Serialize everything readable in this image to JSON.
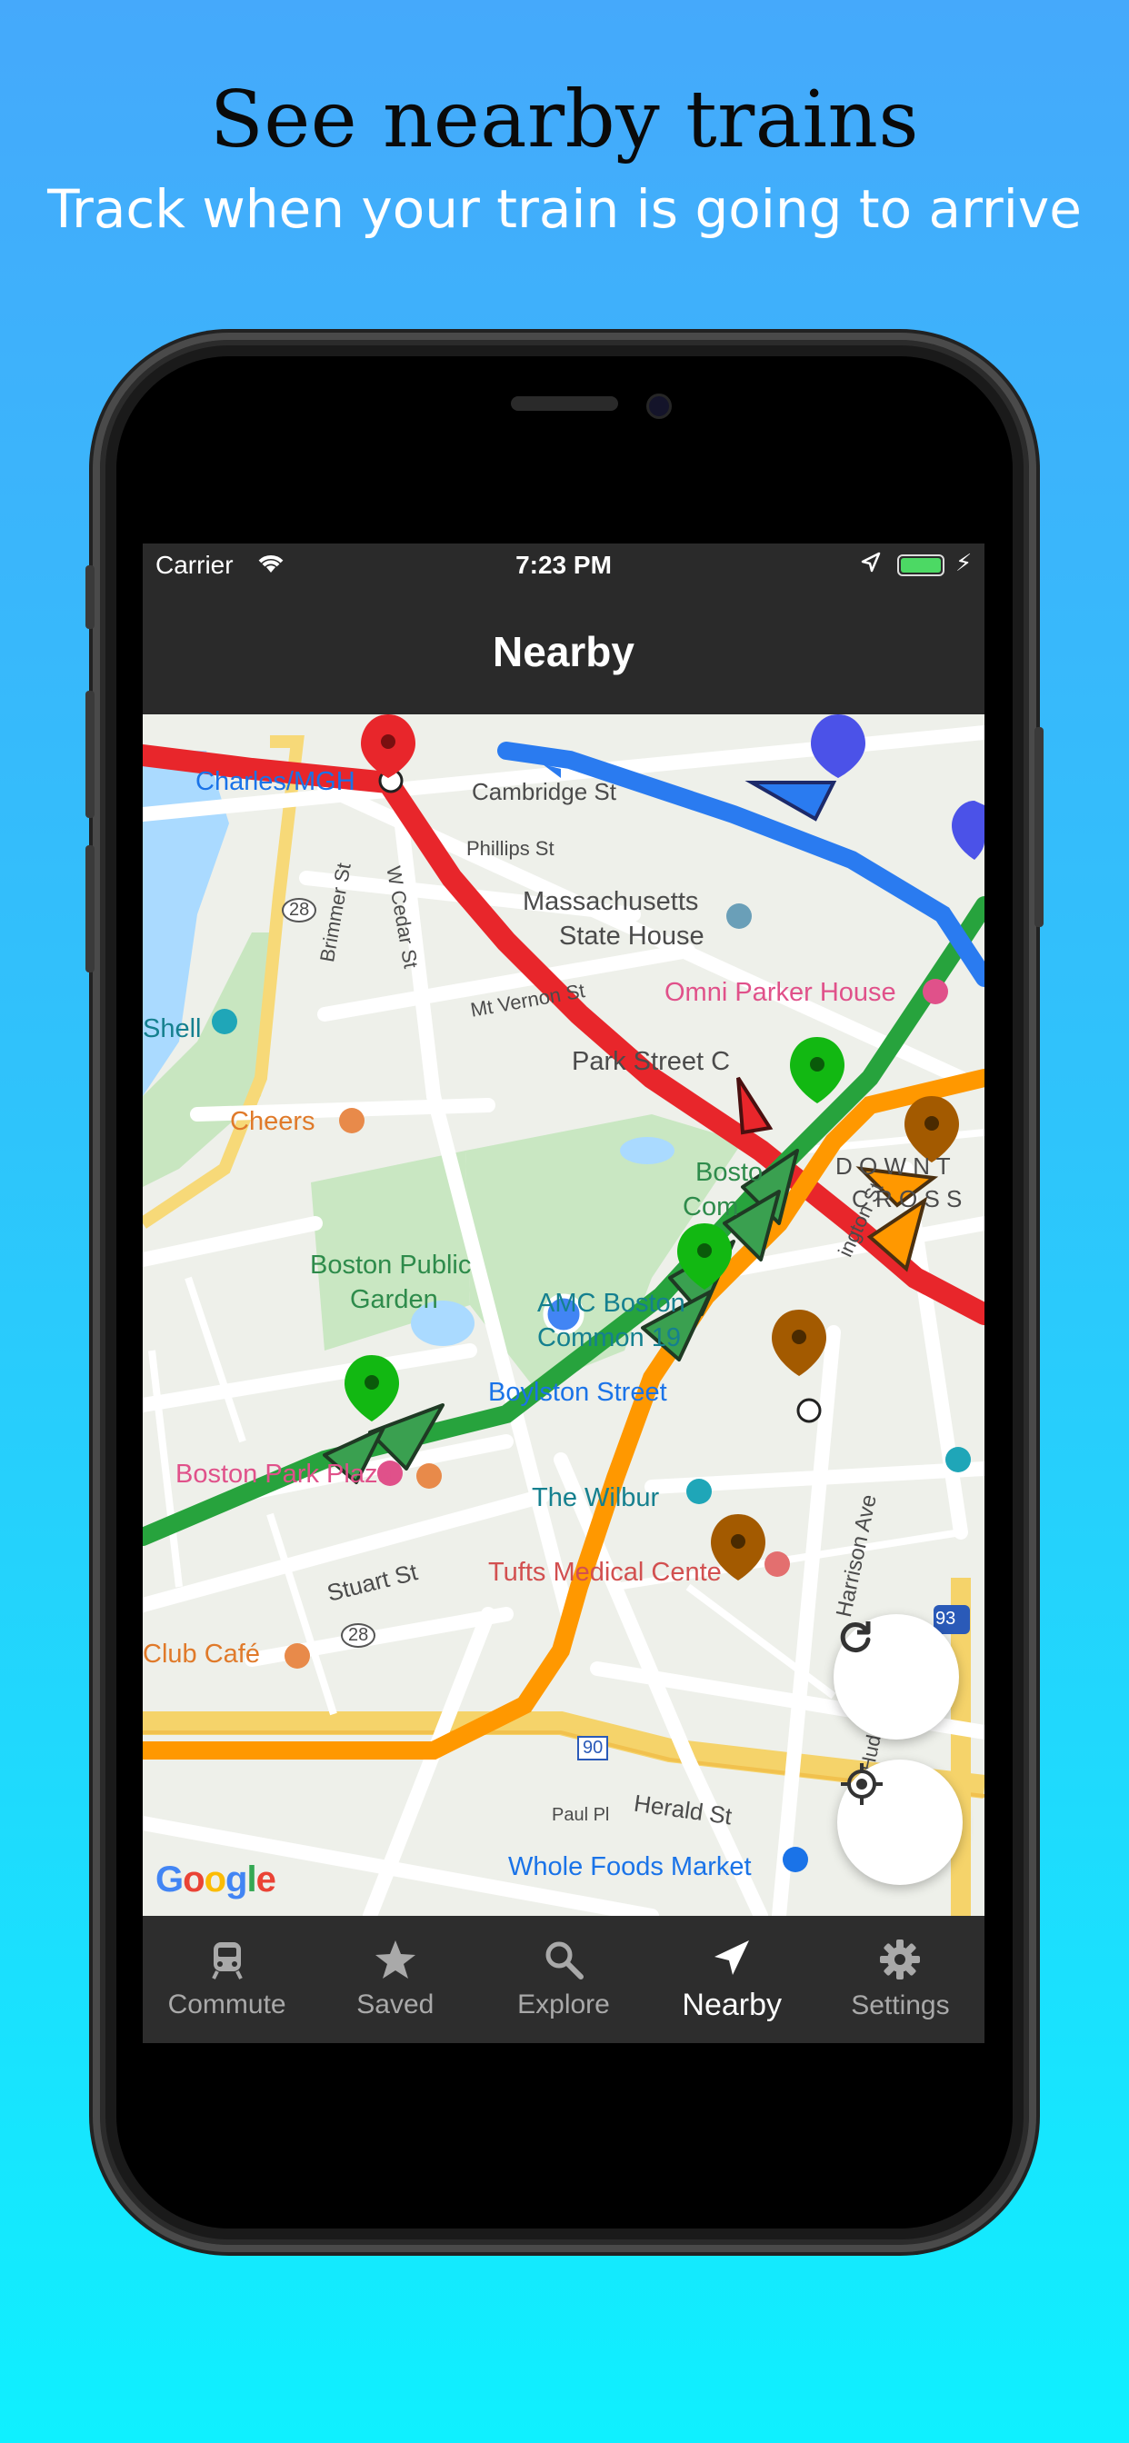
{
  "headline": "See nearby trains",
  "subheadline": "Track when your train is going to arrive",
  "status_bar": {
    "carrier": "Carrier",
    "time": "7:23 PM",
    "wifi_icon": "wifi-icon",
    "location_icon": "location-arrow-icon",
    "battery_icon": "battery-icon"
  },
  "nav": {
    "title": "Nearby"
  },
  "map": {
    "labels": {
      "charles_mgh": "Charles/MGH",
      "cambridge_st": "Cambridge St",
      "phillips_st": "Phillips St",
      "w_cedar_st": "W Cedar St",
      "route_28": "28",
      "ma_state_house_1": "Massachusetts",
      "ma_state_house_2": "State House",
      "brimmer_st": "Brimmer St",
      "mt_vernon_st": "Mt Vernon St",
      "omni": "Omni Parker House",
      "shell": "Shell",
      "park_street": "Park Street C",
      "cheers": "Cheers",
      "boston_common_1": "Bosto",
      "boston_common_2": "Com",
      "downtown_1": "D O W N T",
      "downtown_2": "C R O S S",
      "public_garden_1": "Boston Public",
      "public_garden_2": "Garden",
      "amc_1": "AMC Boston",
      "amc_2": "Common 19",
      "washington_st": "ington St",
      "boylston": "Boylston Street",
      "park_plaza": "Boston Park Plaza",
      "wilbur": "The Wilbur",
      "harrison": "Harrison Ave",
      "stuart_st": "Stuart St",
      "tufts": "Tufts Medical Cente",
      "route_28b": "28",
      "club_cafe": "Club Café",
      "route_93": "93",
      "route_90": "90",
      "hud": "Hud",
      "herald_st": "Herald St",
      "paul_pl": "Paul Pl",
      "whole_foods": "Whole Foods Market",
      "google": "Google"
    },
    "line_colors": {
      "red": "#e8262b",
      "green": "#27a33d",
      "orange": "#ff9800",
      "blue": "#2a7bf0"
    },
    "refresh_icon": "refresh-icon",
    "locate_icon": "locate-icon"
  },
  "tabs": [
    {
      "label": "Commute",
      "icon": "train-icon",
      "active": false
    },
    {
      "label": "Saved",
      "icon": "star-icon",
      "active": false
    },
    {
      "label": "Explore",
      "icon": "search-icon",
      "active": false
    },
    {
      "label": "Nearby",
      "icon": "location-arrow-icon",
      "active": true
    },
    {
      "label": "Settings",
      "icon": "gear-icon",
      "active": false
    }
  ]
}
